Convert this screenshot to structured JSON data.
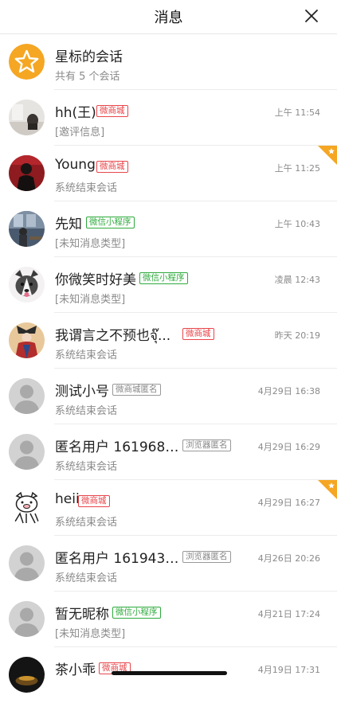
{
  "header": {
    "title": "消息"
  },
  "starred": {
    "title": "星标的会话",
    "subtitle": "共有 5 个会话",
    "icon": "star-icon",
    "accent": "#f5a623"
  },
  "conversations": [
    {
      "name": "hh(王)",
      "tag": "微商城",
      "tag_color": "red",
      "preview": "[邀评信息]",
      "time": "上午 11:54",
      "pinned": false,
      "avatar": "photo-room"
    },
    {
      "name": "Young",
      "tag": "微商城",
      "tag_color": "red",
      "preview": "系统结束会话",
      "time": "上午 11:25",
      "pinned": true,
      "avatar": "photo-portrait-red"
    },
    {
      "name": "先知",
      "tag": "微信小程序",
      "tag_color": "green",
      "preview": "[未知消息类型]",
      "time": "上午 10:43",
      "pinned": false,
      "avatar": "photo-office"
    },
    {
      "name": "你微笑时好美",
      "tag": "微信小程序",
      "tag_color": "green",
      "preview": "[未知消息类型]",
      "time": "凌晨 12:43",
      "pinned": false,
      "avatar": "photo-husky"
    },
    {
      "name": "我谓言之不预也จุ๊...",
      "tag": "微商城",
      "tag_color": "red",
      "preview": "系统结束会话",
      "time": "昨天 20:19",
      "pinned": false,
      "avatar": "photo-costume"
    },
    {
      "name": "测试小号",
      "tag": "微商城匿名",
      "tag_color": "gray",
      "preview": "系统结束会话",
      "time": "4月29日 16:38",
      "pinned": false,
      "avatar": "default-user-icon"
    },
    {
      "name": "匿名用户 1619681...",
      "tag": "浏览器匿名",
      "tag_color": "gray",
      "preview": "系统结束会话",
      "time": "4月29日 16:29",
      "pinned": false,
      "avatar": "default-user-icon"
    },
    {
      "name": "heii",
      "tag": "微商城",
      "tag_color": "red",
      "preview": "系统结束会话",
      "time": "4月29日 16:27",
      "pinned": true,
      "avatar": "cartoon-pig"
    },
    {
      "name": "匿名用户 16194371...",
      "tag": "浏览器匿名",
      "tag_color": "gray",
      "preview": "系统结束会话",
      "time": "4月26日 20:26",
      "pinned": false,
      "avatar": "default-user-icon"
    },
    {
      "name": "暂无昵称",
      "tag": "微信小程序",
      "tag_color": "green",
      "preview": "[未知消息类型]",
      "time": "4月21日 17:24",
      "pinned": false,
      "avatar": "default-user-icon"
    },
    {
      "name": "茶小乖",
      "tag": "微商城",
      "tag_color": "red",
      "preview": "",
      "time": "4月19日 17:31",
      "pinned": false,
      "avatar": "photo-dark"
    }
  ],
  "colors": {
    "tag_red": "#e8454a",
    "tag_green": "#2eaa3c",
    "tag_gray": "#999999",
    "pin_orange": "#f5a623"
  }
}
